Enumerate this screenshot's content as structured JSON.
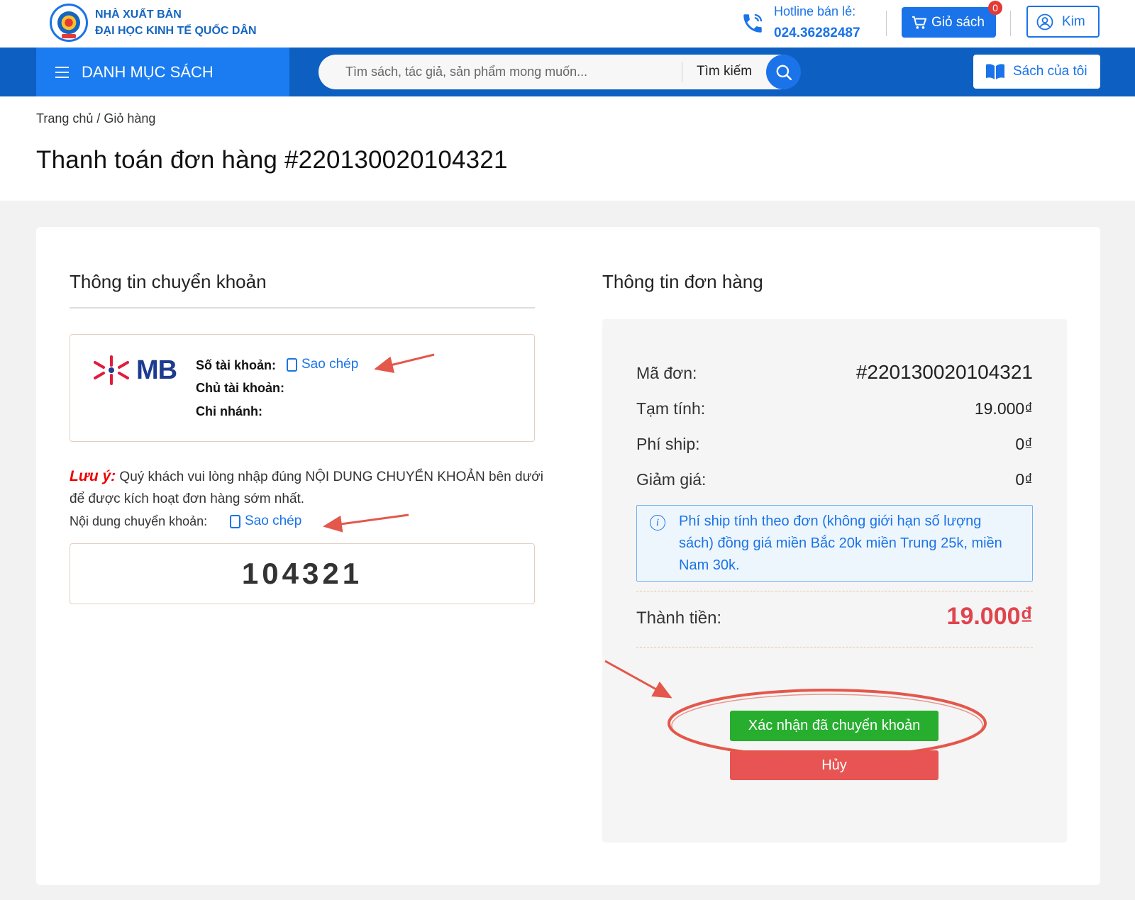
{
  "header": {
    "brand_line1": "NHÀ XUẤT BẢN",
    "brand_line2": "ĐẠI HỌC KINH TẾ QUỐC DÂN",
    "hotline_label": "Hotline bán lẻ:",
    "hotline_number": "024.36282487",
    "cart_label": "Giỏ sách",
    "cart_count": "0",
    "user_label": "Kim"
  },
  "nav": {
    "menu_label": "DANH MỤC SÁCH",
    "search_placeholder": "Tìm sách, tác giả, sản phẩm mong muốn...",
    "search_label": "Tìm kiếm",
    "my_books_label": "Sách của tôi"
  },
  "breadcrumb": "Trang chủ / Giỏ hàng",
  "page_title": "Thanh toán đơn hàng #220130020104321",
  "transfer": {
    "title": "Thông tin chuyển khoản",
    "bank_logo_text": "MB",
    "account_number_label": "Số tài khoản:",
    "account_holder_label": "Chủ tài khoản:",
    "branch_label": "Chi nhánh:",
    "copy_label": "Sao chép",
    "note_prefix": "Lưu ý:",
    "note_text": " Quý khách vui lòng nhập đúng NỘI DUNG CHUYỂN KHOẢN bên dưới để được kích hoạt đơn hàng sớm nhất.",
    "content_label": "Nội dung chuyển khoản:",
    "content_copy_label": "Sao chép",
    "content_code": "104321"
  },
  "order": {
    "title": "Thông tin đơn hàng",
    "rows": [
      {
        "label": "Mã đơn:",
        "value": "#220130020104321"
      },
      {
        "label": "Tạm tính:",
        "value": "19.000₫"
      },
      {
        "label": "Phí ship:",
        "value": "0₫"
      },
      {
        "label": "Giảm giá:",
        "value": "0₫"
      }
    ],
    "shipping_info": "Phí ship tính theo đơn (không giới hạn số lượng sách) đồng giá miền Bắc 20k miền Trung 25k, miền Nam 30k.",
    "total_label": "Thành tiền:",
    "total_value": "19.000₫",
    "confirm_label": "Xác nhận đã chuyển khoản",
    "cancel_label": "Hủy"
  },
  "colors": {
    "primary": "#1a73e8",
    "nav_bg": "#0d5fc2",
    "confirm": "#27ae2f",
    "cancel": "#e85454",
    "total": "#e0444d",
    "annotation": "#e4574b"
  }
}
